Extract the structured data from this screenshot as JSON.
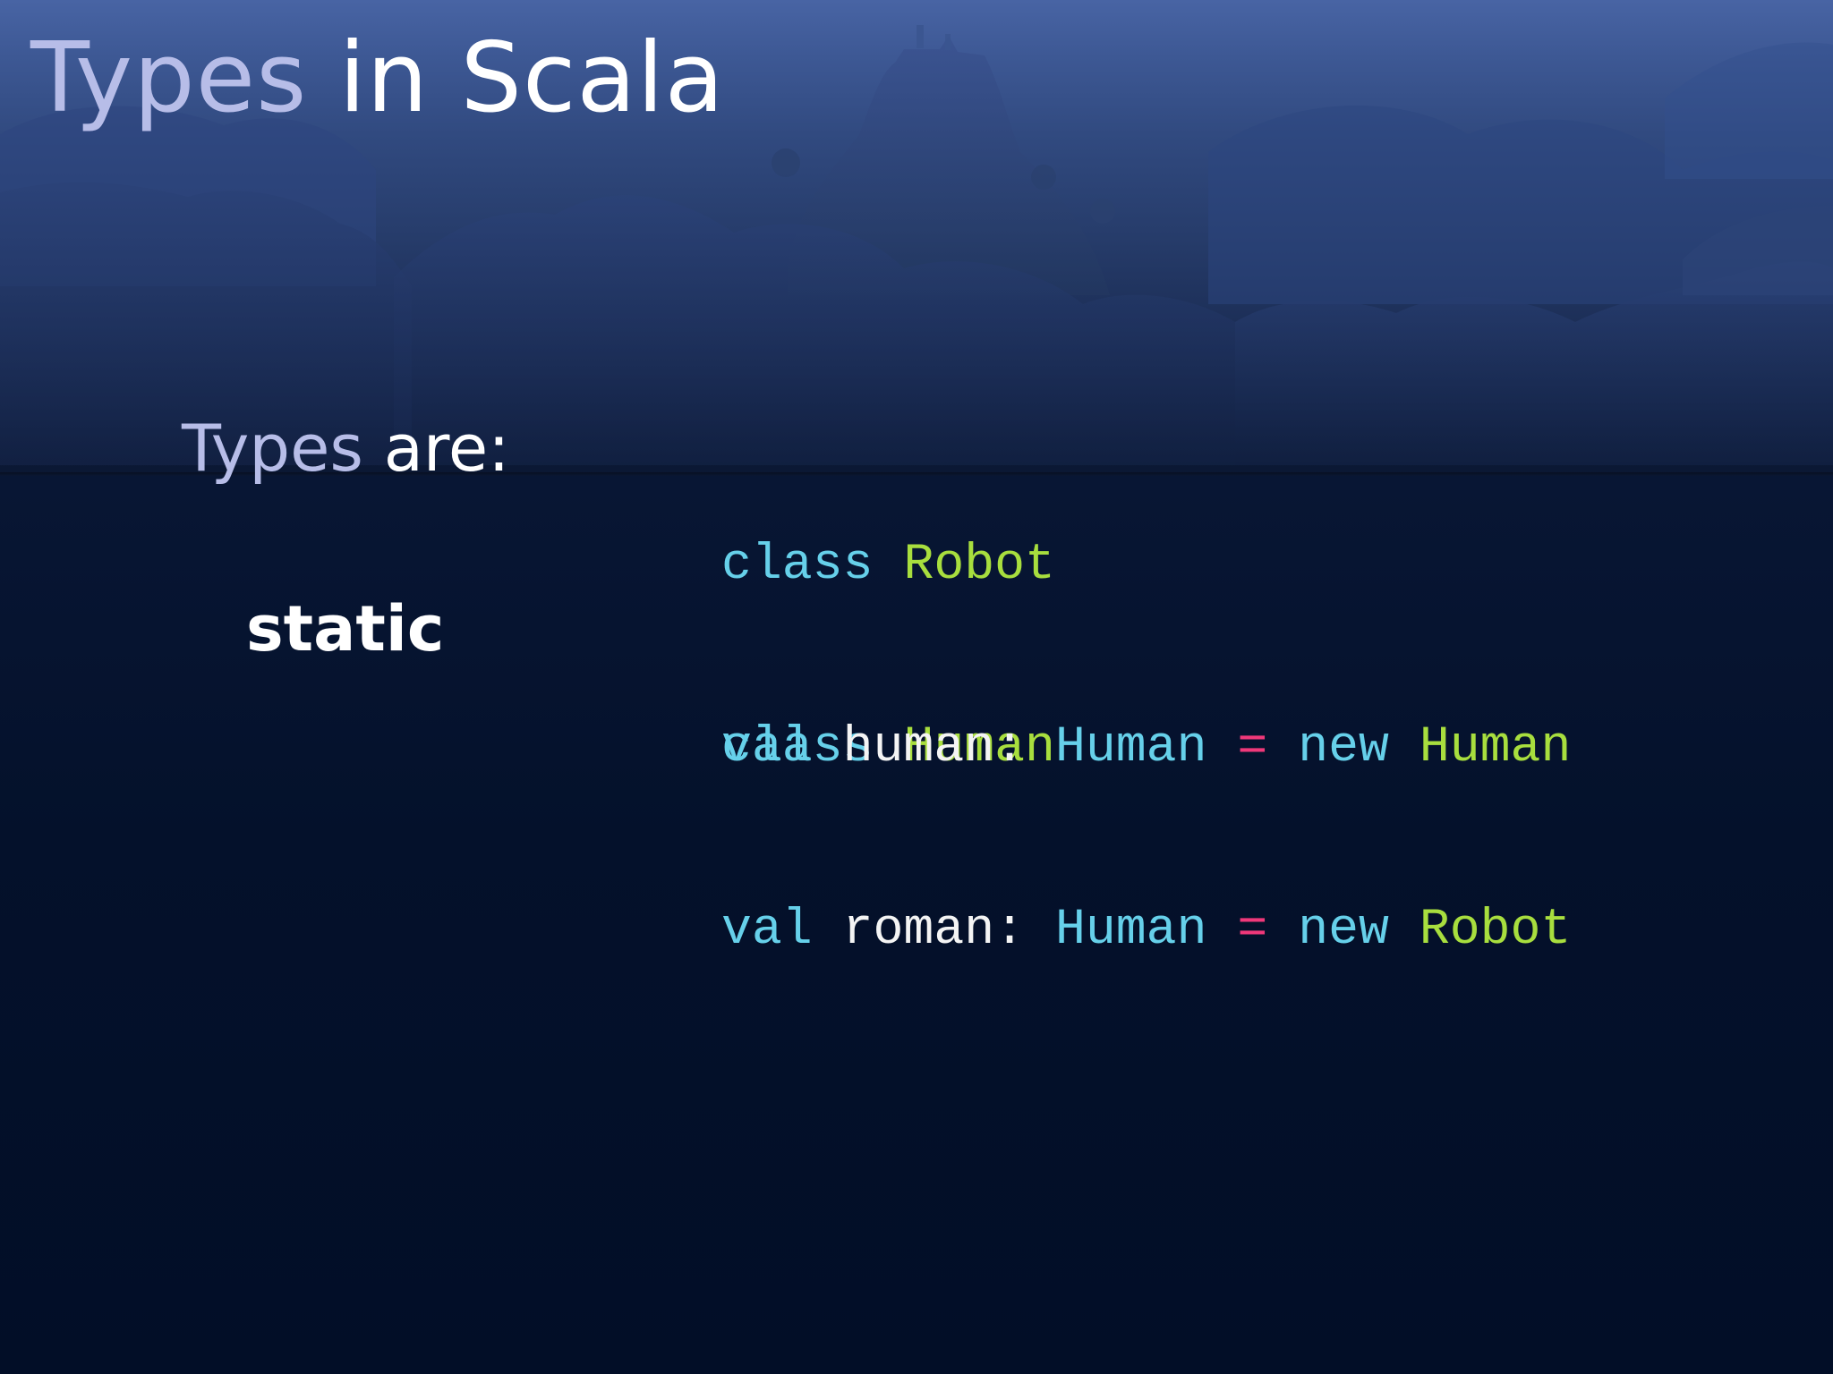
{
  "slide": {
    "title": {
      "part1": "Types",
      "part2": " in Scala"
    },
    "types_label": {
      "part1": "Types",
      "part2": " are:"
    },
    "static_label": "static",
    "code_block_1": [
      {
        "keyword": "class",
        "name": "Robot"
      },
      {
        "keyword": "class",
        "name": "Human"
      }
    ],
    "code_block_2": [
      {
        "keyword": "val",
        "identifier": "human:",
        "type": "Human",
        "operator": "=",
        "new_keyword": "new",
        "constructor": "Human"
      },
      {
        "keyword": "val",
        "identifier": "roman:",
        "type": "Human",
        "operator": "=",
        "new_keyword": "new",
        "constructor": "Robot"
      }
    ]
  },
  "colors": {
    "keyword": "#66d0ea",
    "class_name": "#a8de3e",
    "identifier": "#f4f4f4",
    "operator": "#f0387a",
    "title_dim": "#b7bde8",
    "title_bright": "#ffffff",
    "background": "#03102a"
  }
}
